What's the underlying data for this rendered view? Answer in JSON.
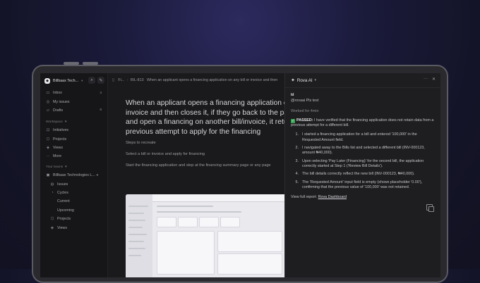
{
  "sidebar": {
    "workspace": "Billbaax Tech...",
    "items": [
      {
        "label": "Inbox",
        "badge": "3",
        "icon": "inbox-icon"
      },
      {
        "label": "My issues",
        "badge": "",
        "icon": "target-icon"
      },
      {
        "label": "Drafts",
        "badge": "8",
        "icon": "draft-icon"
      }
    ],
    "workspace_section": "Workspace",
    "workspace_items": [
      {
        "label": "Initiatives",
        "icon": "initiative-icon"
      },
      {
        "label": "Projects",
        "icon": "projects-icon"
      },
      {
        "label": "Views",
        "icon": "views-icon"
      },
      {
        "label": "More",
        "icon": "more-icon"
      }
    ],
    "teams_section": "Your teams",
    "team": "Billbaax Technologies L...",
    "team_items": [
      {
        "label": "Issues",
        "indent": 1
      },
      {
        "label": "Cycles",
        "indent": 1
      },
      {
        "label": "Current",
        "indent": 2
      },
      {
        "label": "Upcoming",
        "indent": 2
      },
      {
        "label": "Projects",
        "indent": 1
      },
      {
        "label": "Views",
        "indent": 1
      }
    ]
  },
  "main": {
    "crumb_prefix": "Fi...",
    "crumb_issue": "BIL-813",
    "crumb_title": "When an applicant opens a financing application on any bill or invoice and then",
    "title": "When an applicant opens a financing application on any bill or invoice and then closes it, if they go back to the payables page and open a financing on another bill/invoice, it returns the previous attempt to apply for the financing",
    "steps_heading": "Steps to recreate",
    "step1": "Select a bill or invoice and apply for financing",
    "step2": "Start the financing application and stop at the financing summary page or any page"
  },
  "ai": {
    "title": "Rova AI",
    "user_initials": "Id",
    "mention": "@rovaai Pls test",
    "worked": "Worked for 4min",
    "passed_label": "PASSED:",
    "passed_text": " I have verified that the financing application does not retain data from a previous attempt for a different bill.",
    "steps": [
      {
        "n": "1.",
        "text": "I started a financing application for a bill and entered '100,000' in the Requested Amount field."
      },
      {
        "n": "2.",
        "text": "I navigated away to the Bills list and selected a different bill (INV-000123, amount ₦40,000)."
      },
      {
        "n": "3.",
        "text": "Upon selecting 'Pay Later (Financing)' for the second bill, the application correctly started at Step 1 ('Review Bill Details')."
      },
      {
        "n": "4.",
        "text": "The bill details correctly reflect the new bill (INV-000123, ₦40,000)."
      },
      {
        "n": "5.",
        "text": "The 'Requested Amount' input field is empty (shows placeholder '0.00'), confirming that the previous value of '100,000' was not retained."
      }
    ],
    "report_label": "View full report: ",
    "report_link": "Rova Dashboard"
  }
}
